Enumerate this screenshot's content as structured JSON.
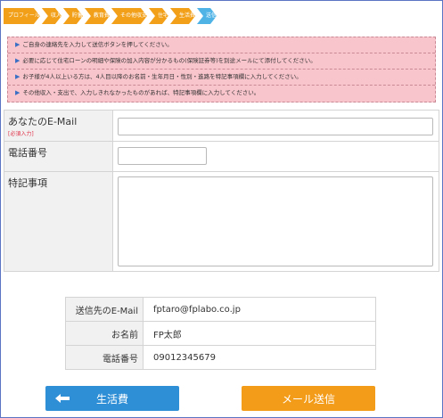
{
  "steps": [
    {
      "label": "プロフィール"
    },
    {
      "label": "収入"
    },
    {
      "label": "貯蓄"
    },
    {
      "label": "教育費"
    },
    {
      "label": "その他収支"
    },
    {
      "label": "住宅"
    },
    {
      "label": "生活費"
    },
    {
      "label": "送信"
    }
  ],
  "current_step": "送信",
  "notes": [
    "ご自身の連絡先を入力して送信ボタンを押してください。",
    "必要に応じて住宅ローンの明細や保険の加入内容が分かるもの(保険証券等)を別途メールにて添付してください。",
    "お子様が4人以上いる方は、4人目以降のお名前・生年月日・性別・進路を特記事項欄に入力してください。",
    "その他収入・支出で、入力しきれなかったものがあれば、特記事項欄に入力してください。"
  ],
  "form": {
    "email_label": "あなたのE-Mail",
    "required_label": "[必須入力]",
    "email_value": "",
    "phone_label": "電話番号",
    "phone_value": "",
    "notes_label": "特記事項",
    "notes_value": ""
  },
  "summary": {
    "rows": [
      {
        "key": "送信先のE-Mail",
        "value": "fptaro@fplabo.co.jp"
      },
      {
        "key": "お名前",
        "value": "FP太郎"
      },
      {
        "key": "電話番号",
        "value": "09012345679"
      }
    ]
  },
  "buttons": {
    "back_label": "生活費",
    "send_label": "メール送信",
    "back_icon": "arrow-left-icon"
  },
  "colors": {
    "step": "#f2a019",
    "step_current": "#4fb3e6",
    "notes_bg": "#f9c5cc",
    "back_button": "#2f8fd6",
    "send_button": "#f39c19",
    "required": "#e0344a"
  }
}
